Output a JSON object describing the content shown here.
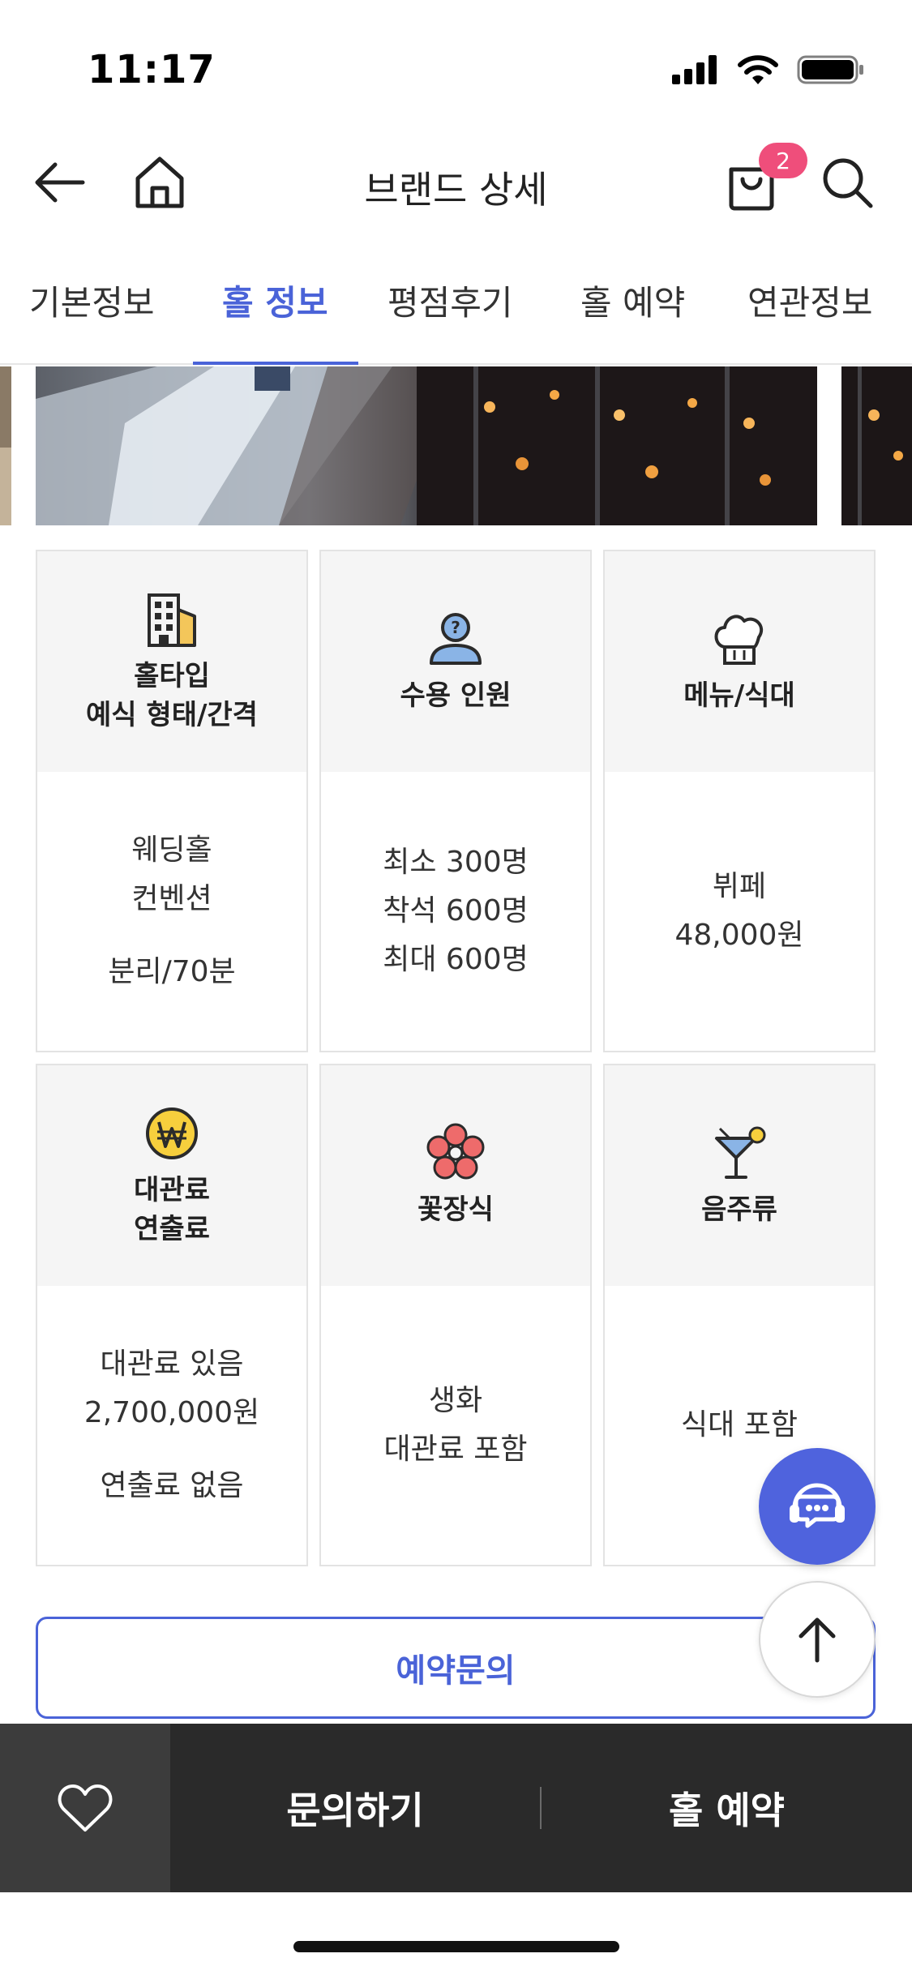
{
  "status": {
    "time": "11:17"
  },
  "header": {
    "title": "브랜드 상세",
    "cart_count": "2"
  },
  "tabs": [
    {
      "label": "기본정보"
    },
    {
      "label": "홀 정보"
    },
    {
      "label": "평점후기"
    },
    {
      "label": "홀 예약"
    },
    {
      "label": "연관정보"
    }
  ],
  "cards": [
    {
      "icon": "building-icon",
      "title_lines": [
        "홀타입",
        "예식 형태/간격"
      ],
      "body_lines": [
        "웨딩홀",
        "컨벤션",
        "",
        "분리/70분"
      ]
    },
    {
      "icon": "person-question-icon",
      "title_lines": [
        "수용 인원"
      ],
      "body_lines": [
        "최소 300명",
        "착석 600명",
        "최대 600명"
      ]
    },
    {
      "icon": "chef-hat-icon",
      "title_lines": [
        "메뉴/식대"
      ],
      "body_lines": [
        "뷔페",
        "48,000원"
      ]
    },
    {
      "icon": "won-coin-icon",
      "title_lines": [
        "대관료",
        "연출료"
      ],
      "body_lines": [
        "대관료 있음",
        "2,700,000원",
        "",
        "연출료 없음"
      ]
    },
    {
      "icon": "flower-icon",
      "title_lines": [
        "꽃장식"
      ],
      "body_lines": [
        "생화",
        "대관료 포함"
      ]
    },
    {
      "icon": "cocktail-icon",
      "title_lines": [
        "음주류"
      ],
      "body_lines": [
        "식대 포함"
      ]
    }
  ],
  "reserve_button": "예약문의",
  "bottom_bar": {
    "inquiry": "문의하기",
    "reserve": "홀 예약"
  },
  "colors": {
    "accent": "#4a63d8",
    "badge": "#ef4e7b",
    "bottom_bar": "#2a2a2a"
  }
}
